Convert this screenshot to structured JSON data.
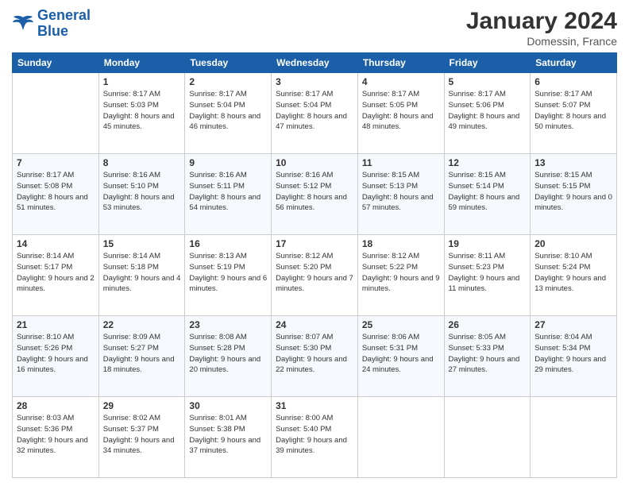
{
  "header": {
    "logo_line1": "General",
    "logo_line2": "Blue",
    "month": "January 2024",
    "location": "Domessin, France"
  },
  "weekdays": [
    "Sunday",
    "Monday",
    "Tuesday",
    "Wednesday",
    "Thursday",
    "Friday",
    "Saturday"
  ],
  "weeks": [
    [
      {
        "day": "",
        "sunrise": "",
        "sunset": "",
        "daylight": ""
      },
      {
        "day": "1",
        "sunrise": "Sunrise: 8:17 AM",
        "sunset": "Sunset: 5:03 PM",
        "daylight": "Daylight: 8 hours and 45 minutes."
      },
      {
        "day": "2",
        "sunrise": "Sunrise: 8:17 AM",
        "sunset": "Sunset: 5:04 PM",
        "daylight": "Daylight: 8 hours and 46 minutes."
      },
      {
        "day": "3",
        "sunrise": "Sunrise: 8:17 AM",
        "sunset": "Sunset: 5:04 PM",
        "daylight": "Daylight: 8 hours and 47 minutes."
      },
      {
        "day": "4",
        "sunrise": "Sunrise: 8:17 AM",
        "sunset": "Sunset: 5:05 PM",
        "daylight": "Daylight: 8 hours and 48 minutes."
      },
      {
        "day": "5",
        "sunrise": "Sunrise: 8:17 AM",
        "sunset": "Sunset: 5:06 PM",
        "daylight": "Daylight: 8 hours and 49 minutes."
      },
      {
        "day": "6",
        "sunrise": "Sunrise: 8:17 AM",
        "sunset": "Sunset: 5:07 PM",
        "daylight": "Daylight: 8 hours and 50 minutes."
      }
    ],
    [
      {
        "day": "7",
        "sunrise": "Sunrise: 8:17 AM",
        "sunset": "Sunset: 5:08 PM",
        "daylight": "Daylight: 8 hours and 51 minutes."
      },
      {
        "day": "8",
        "sunrise": "Sunrise: 8:16 AM",
        "sunset": "Sunset: 5:10 PM",
        "daylight": "Daylight: 8 hours and 53 minutes."
      },
      {
        "day": "9",
        "sunrise": "Sunrise: 8:16 AM",
        "sunset": "Sunset: 5:11 PM",
        "daylight": "Daylight: 8 hours and 54 minutes."
      },
      {
        "day": "10",
        "sunrise": "Sunrise: 8:16 AM",
        "sunset": "Sunset: 5:12 PM",
        "daylight": "Daylight: 8 hours and 56 minutes."
      },
      {
        "day": "11",
        "sunrise": "Sunrise: 8:15 AM",
        "sunset": "Sunset: 5:13 PM",
        "daylight": "Daylight: 8 hours and 57 minutes."
      },
      {
        "day": "12",
        "sunrise": "Sunrise: 8:15 AM",
        "sunset": "Sunset: 5:14 PM",
        "daylight": "Daylight: 8 hours and 59 minutes."
      },
      {
        "day": "13",
        "sunrise": "Sunrise: 8:15 AM",
        "sunset": "Sunset: 5:15 PM",
        "daylight": "Daylight: 9 hours and 0 minutes."
      }
    ],
    [
      {
        "day": "14",
        "sunrise": "Sunrise: 8:14 AM",
        "sunset": "Sunset: 5:17 PM",
        "daylight": "Daylight: 9 hours and 2 minutes."
      },
      {
        "day": "15",
        "sunrise": "Sunrise: 8:14 AM",
        "sunset": "Sunset: 5:18 PM",
        "daylight": "Daylight: 9 hours and 4 minutes."
      },
      {
        "day": "16",
        "sunrise": "Sunrise: 8:13 AM",
        "sunset": "Sunset: 5:19 PM",
        "daylight": "Daylight: 9 hours and 6 minutes."
      },
      {
        "day": "17",
        "sunrise": "Sunrise: 8:12 AM",
        "sunset": "Sunset: 5:20 PM",
        "daylight": "Daylight: 9 hours and 7 minutes."
      },
      {
        "day": "18",
        "sunrise": "Sunrise: 8:12 AM",
        "sunset": "Sunset: 5:22 PM",
        "daylight": "Daylight: 9 hours and 9 minutes."
      },
      {
        "day": "19",
        "sunrise": "Sunrise: 8:11 AM",
        "sunset": "Sunset: 5:23 PM",
        "daylight": "Daylight: 9 hours and 11 minutes."
      },
      {
        "day": "20",
        "sunrise": "Sunrise: 8:10 AM",
        "sunset": "Sunset: 5:24 PM",
        "daylight": "Daylight: 9 hours and 13 minutes."
      }
    ],
    [
      {
        "day": "21",
        "sunrise": "Sunrise: 8:10 AM",
        "sunset": "Sunset: 5:26 PM",
        "daylight": "Daylight: 9 hours and 16 minutes."
      },
      {
        "day": "22",
        "sunrise": "Sunrise: 8:09 AM",
        "sunset": "Sunset: 5:27 PM",
        "daylight": "Daylight: 9 hours and 18 minutes."
      },
      {
        "day": "23",
        "sunrise": "Sunrise: 8:08 AM",
        "sunset": "Sunset: 5:28 PM",
        "daylight": "Daylight: 9 hours and 20 minutes."
      },
      {
        "day": "24",
        "sunrise": "Sunrise: 8:07 AM",
        "sunset": "Sunset: 5:30 PM",
        "daylight": "Daylight: 9 hours and 22 minutes."
      },
      {
        "day": "25",
        "sunrise": "Sunrise: 8:06 AM",
        "sunset": "Sunset: 5:31 PM",
        "daylight": "Daylight: 9 hours and 24 minutes."
      },
      {
        "day": "26",
        "sunrise": "Sunrise: 8:05 AM",
        "sunset": "Sunset: 5:33 PM",
        "daylight": "Daylight: 9 hours and 27 minutes."
      },
      {
        "day": "27",
        "sunrise": "Sunrise: 8:04 AM",
        "sunset": "Sunset: 5:34 PM",
        "daylight": "Daylight: 9 hours and 29 minutes."
      }
    ],
    [
      {
        "day": "28",
        "sunrise": "Sunrise: 8:03 AM",
        "sunset": "Sunset: 5:36 PM",
        "daylight": "Daylight: 9 hours and 32 minutes."
      },
      {
        "day": "29",
        "sunrise": "Sunrise: 8:02 AM",
        "sunset": "Sunset: 5:37 PM",
        "daylight": "Daylight: 9 hours and 34 minutes."
      },
      {
        "day": "30",
        "sunrise": "Sunrise: 8:01 AM",
        "sunset": "Sunset: 5:38 PM",
        "daylight": "Daylight: 9 hours and 37 minutes."
      },
      {
        "day": "31",
        "sunrise": "Sunrise: 8:00 AM",
        "sunset": "Sunset: 5:40 PM",
        "daylight": "Daylight: 9 hours and 39 minutes."
      },
      {
        "day": "",
        "sunrise": "",
        "sunset": "",
        "daylight": ""
      },
      {
        "day": "",
        "sunrise": "",
        "sunset": "",
        "daylight": ""
      },
      {
        "day": "",
        "sunrise": "",
        "sunset": "",
        "daylight": ""
      }
    ]
  ]
}
